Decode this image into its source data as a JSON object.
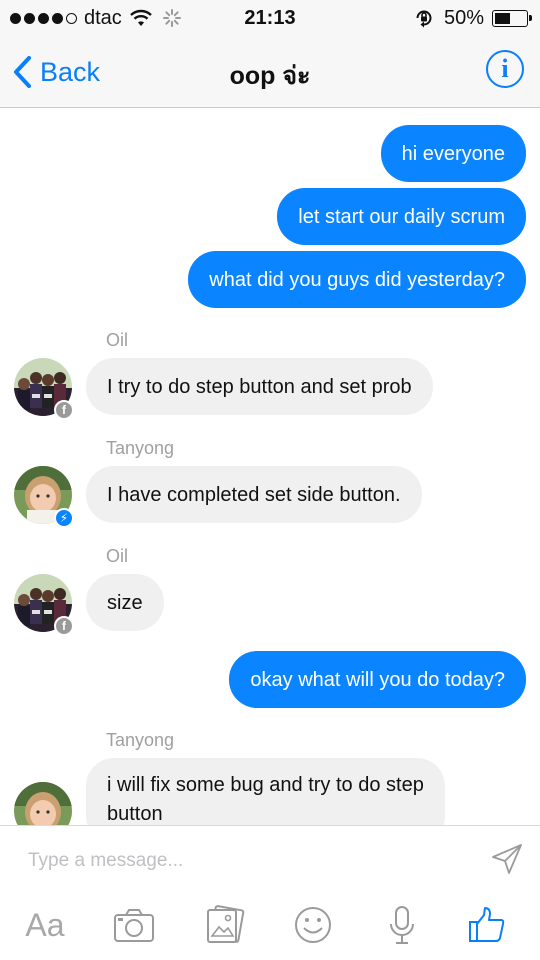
{
  "status_bar": {
    "carrier": "dtac",
    "time": "21:13",
    "battery_percent": "50%",
    "battery_level": 0.5,
    "signal_bars_filled": 4,
    "signal_bars_total": 5
  },
  "nav": {
    "back_label": "Back",
    "title": "oop จ่ะ",
    "info_label": "i"
  },
  "messages": [
    {
      "type": "outgoing",
      "text": "hi everyone"
    },
    {
      "type": "outgoing",
      "text": "let start our daily scrum"
    },
    {
      "type": "outgoing",
      "text": "what did you guys did yesterday?"
    },
    {
      "type": "incoming",
      "sender": "Oil",
      "text": "I try to do step button and set prob",
      "avatar": "group-photo",
      "badge": "facebook"
    },
    {
      "type": "incoming",
      "sender": "Tanyong",
      "text": "I have completed set side button.",
      "avatar": "person-photo",
      "badge": "messenger"
    },
    {
      "type": "incoming",
      "sender": "Oil",
      "text": "size",
      "avatar": "group-photo",
      "badge": "facebook"
    },
    {
      "type": "outgoing",
      "text": "okay what will you do today?"
    },
    {
      "type": "incoming",
      "sender": "Tanyong",
      "text_line1": "i will fix some bug and try to do step",
      "text_line2": "button",
      "avatar": "person-photo",
      "badge": "messenger"
    }
  ],
  "composer": {
    "placeholder": "Type a message...",
    "text_tool_label": "Aa",
    "icons": [
      "send-icon",
      "camera-icon",
      "photo-gallery-icon",
      "emoji-icon",
      "microphone-icon",
      "like-thumb-icon"
    ]
  },
  "colors": {
    "accent": "#0a7ffb",
    "outgoing_bubble": "#0a84ff",
    "incoming_bubble": "#f0f0f0",
    "sender_name": "#a0a0a0"
  }
}
